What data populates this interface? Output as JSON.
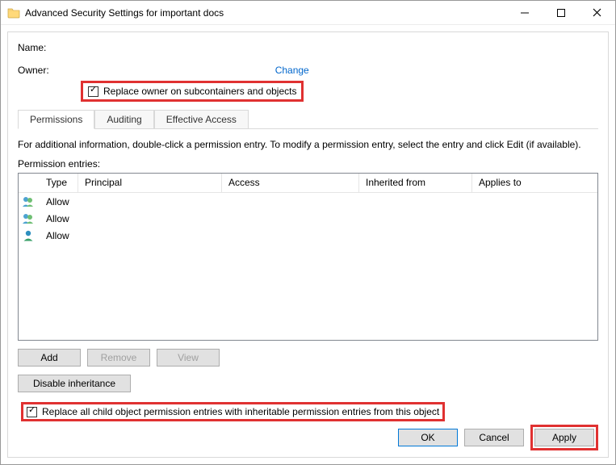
{
  "titlebar": {
    "title": "Advanced Security Settings for important docs"
  },
  "header": {
    "name_label": "Name:",
    "owner_label": "Owner:",
    "change_link": "Change",
    "replace_owner_label": "Replace owner on subcontainers and objects"
  },
  "tabs": {
    "permissions": "Permissions",
    "auditing": "Auditing",
    "effective": "Effective Access"
  },
  "body": {
    "info_text": "For additional information, double-click a permission entry. To modify a permission entry, select the entry and click Edit (if available).",
    "entries_label": "Permission entries:"
  },
  "columns": {
    "type": "Type",
    "principal": "Principal",
    "access": "Access",
    "inherited": "Inherited from",
    "applies": "Applies to"
  },
  "rows": [
    {
      "icon": "group",
      "type": "Allow",
      "principal": "",
      "access": "",
      "inherited": "",
      "applies": ""
    },
    {
      "icon": "group",
      "type": "Allow",
      "principal": "",
      "access": "",
      "inherited": "",
      "applies": ""
    },
    {
      "icon": "user",
      "type": "Allow",
      "principal": "",
      "access": "",
      "inherited": "",
      "applies": ""
    }
  ],
  "buttons": {
    "add": "Add",
    "remove": "Remove",
    "view": "View",
    "disable_inh": "Disable inheritance",
    "ok": "OK",
    "cancel": "Cancel",
    "apply": "Apply"
  },
  "replace_child_label": "Replace all child object permission entries with inheritable permission entries from this object"
}
